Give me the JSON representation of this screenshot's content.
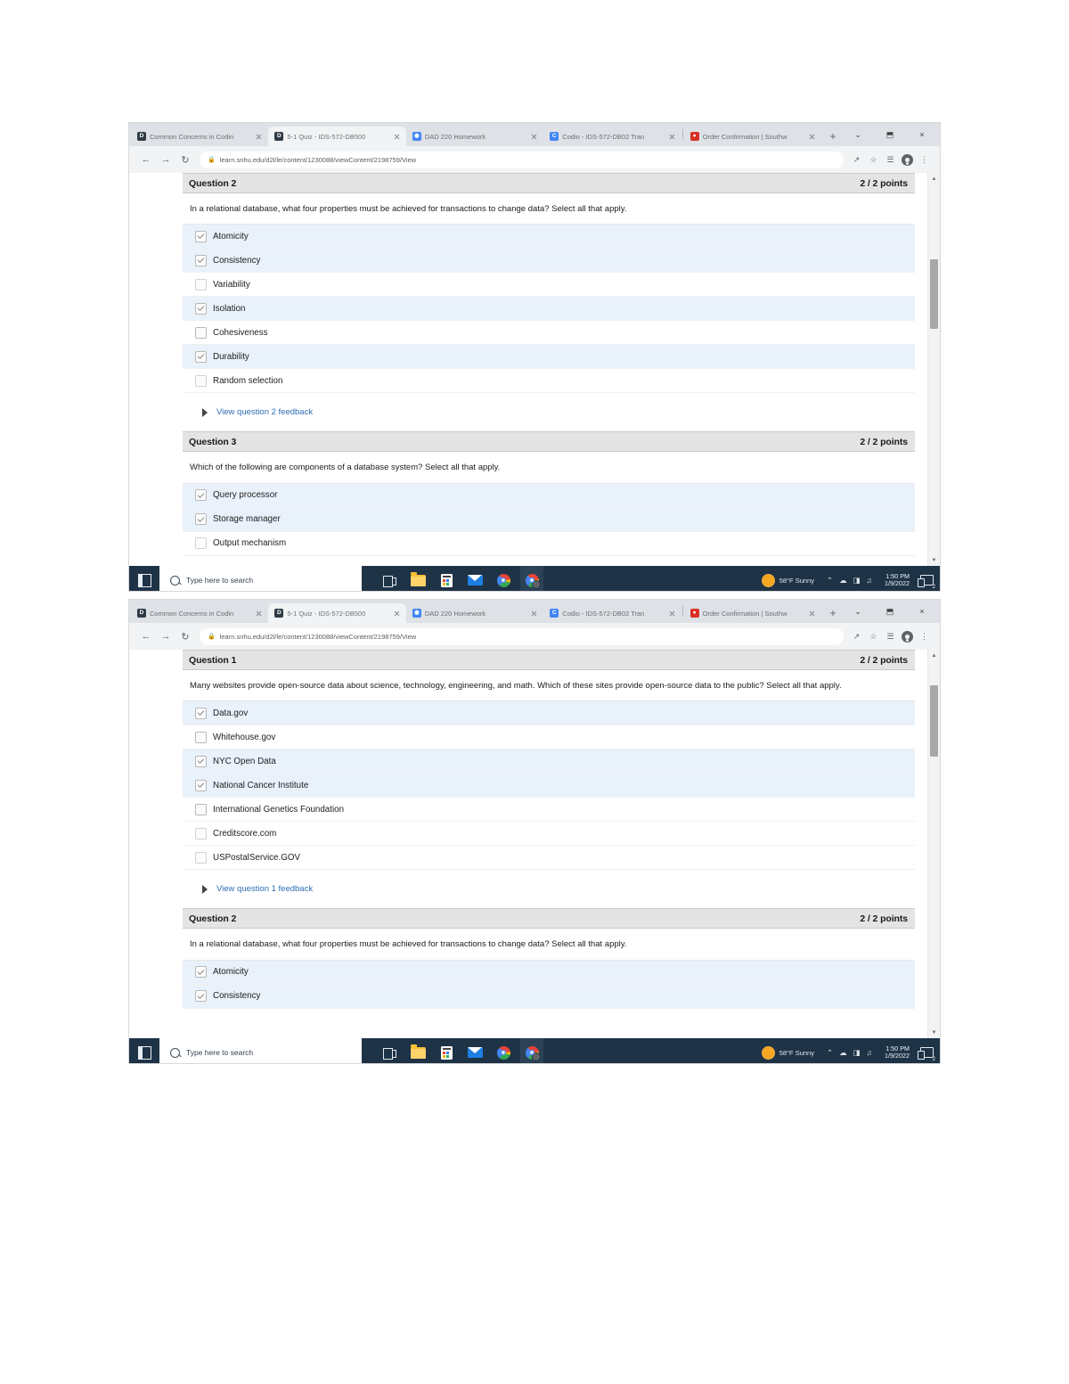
{
  "browser": {
    "tabs": [
      {
        "title": "Common Concerns in Codin",
        "favicon": "d2l-icon",
        "active": false
      },
      {
        "title": "5-1 Quiz - IDS-572-DB500",
        "favicon": "d2l-icon",
        "active": true
      },
      {
        "title": "DAD 220 Homework",
        "favicon": "globe-icon",
        "active": false
      },
      {
        "title": "Codio - IDS-572-DB02 Tran",
        "favicon": "codio-icon",
        "active": false
      },
      {
        "title": "Order Confirmation | Southw",
        "favicon": "southwest-icon",
        "active": false
      }
    ],
    "new_tab_label": "+",
    "window_controls": {
      "minimize": "⌄",
      "maximize": "⬒",
      "close": "×"
    },
    "url": "learn.snhu.edu/d2l/le/content/1230088/viewContent/2198759/View",
    "nav": {
      "back": "←",
      "forward": "→",
      "reload": "↻"
    },
    "lock_label": "🔒",
    "omnibox_icons": [
      "share-icon",
      "bookmark-star-icon",
      "extensions-icon",
      "profile-avatar-icon",
      "chrome-menu-icon"
    ]
  },
  "window_top": {
    "questions": [
      {
        "id": "q2",
        "title": "Question 2",
        "points": "2 / 2 points",
        "text": "In a relational database, what four properties must be achieved for transactions to change data? Select all that apply.",
        "options": [
          {
            "label": "Atomicity",
            "checked": true,
            "shaded": true
          },
          {
            "label": "Consistency",
            "checked": true,
            "shaded": true
          },
          {
            "label": "Variability",
            "checked": false,
            "shaded": false
          },
          {
            "label": "Isolation",
            "checked": true,
            "shaded": true
          },
          {
            "label": "Cohesiveness",
            "checked": false,
            "shaded": false
          },
          {
            "label": "Durability",
            "checked": true,
            "shaded": true
          },
          {
            "label": "Random selection",
            "checked": false,
            "shaded": false
          }
        ],
        "feedback_link": "View question 2 feedback"
      },
      {
        "id": "q3",
        "title": "Question 3",
        "points": "2 / 2 points",
        "text": "Which of the following are components of a database system? Select all that apply.",
        "options": [
          {
            "label": "Query processor",
            "checked": true,
            "shaded": true
          },
          {
            "label": "Storage manager",
            "checked": true,
            "shaded": true
          },
          {
            "label": "Output mechanism",
            "checked": false,
            "shaded": false
          }
        ]
      }
    ]
  },
  "window_bottom": {
    "questions": [
      {
        "id": "q1",
        "title": "Question 1",
        "points": "2 / 2 points",
        "text": "Many websites provide open-source data about science, technology, engineering, and math. Which of these sites provide open-source data to the public? Select all that apply.",
        "options": [
          {
            "label": "Data.gov",
            "checked": true,
            "shaded": true
          },
          {
            "label": "Whitehouse.gov",
            "checked": false,
            "shaded": false
          },
          {
            "label": "NYC Open Data",
            "checked": true,
            "shaded": true
          },
          {
            "label": "National Cancer Institute",
            "checked": true,
            "shaded": true
          },
          {
            "label": "International Genetics Foundation",
            "checked": false,
            "shaded": false
          },
          {
            "label": "Creditscore.com",
            "checked": false,
            "shaded": false
          },
          {
            "label": "USPostalService.GOV",
            "checked": false,
            "shaded": false
          }
        ],
        "feedback_link": "View question 1 feedback"
      },
      {
        "id": "q2b",
        "title": "Question 2",
        "points": "2 / 2 points",
        "text": "In a relational database, what four properties must be achieved for transactions to change data? Select all that apply.",
        "options": [
          {
            "label": "Atomicity",
            "checked": true,
            "shaded": true
          },
          {
            "label": "Consistency",
            "checked": true,
            "shaded": true
          }
        ]
      }
    ]
  },
  "taskbar": {
    "search_placeholder": "Type here to search",
    "apps": [
      "task-view-icon",
      "file-explorer-icon",
      "microsoft-store-icon",
      "mail-icon",
      "chrome-icon",
      "chrome-active-icon"
    ],
    "weather": "58°F  Sunny",
    "tray": [
      "⌃",
      "☁",
      "◨",
      "♫"
    ],
    "time": "1:50 PM",
    "date": "1/9/2022",
    "notification_count": "2"
  }
}
